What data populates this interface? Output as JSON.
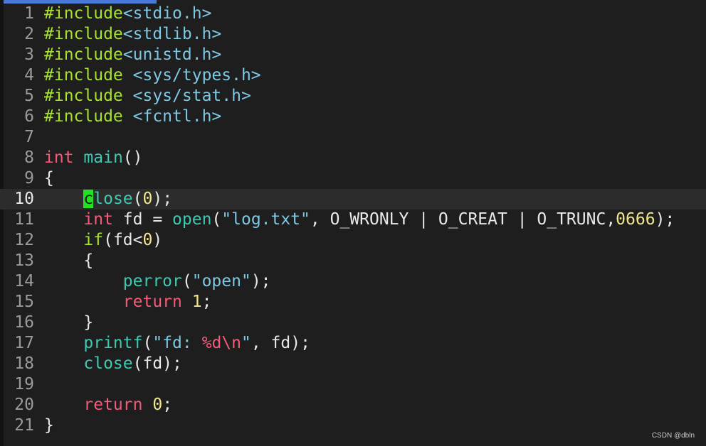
{
  "window": {
    "watermark": "CSDN @dbln"
  },
  "editor": {
    "current_line": "10",
    "lines": [
      {
        "num": "1",
        "tokens": [
          {
            "t": "#include",
            "c": "kw-pre"
          },
          {
            "t": "<stdio.h>",
            "c": "str"
          }
        ]
      },
      {
        "num": "2",
        "tokens": [
          {
            "t": "#include",
            "c": "kw-pre"
          },
          {
            "t": "<stdlib.h>",
            "c": "str"
          }
        ]
      },
      {
        "num": "3",
        "tokens": [
          {
            "t": "#include",
            "c": "kw-pre"
          },
          {
            "t": "<unistd.h>",
            "c": "str"
          }
        ]
      },
      {
        "num": "4",
        "tokens": [
          {
            "t": "#include",
            "c": "kw-pre"
          },
          {
            "t": " ",
            "c": "plain"
          },
          {
            "t": "<sys/types.h>",
            "c": "str"
          }
        ]
      },
      {
        "num": "5",
        "tokens": [
          {
            "t": "#include",
            "c": "kw-pre"
          },
          {
            "t": " ",
            "c": "plain"
          },
          {
            "t": "<sys/stat.h>",
            "c": "str"
          }
        ]
      },
      {
        "num": "6",
        "tokens": [
          {
            "t": "#include",
            "c": "kw-pre"
          },
          {
            "t": " ",
            "c": "plain"
          },
          {
            "t": "<fcntl.h>",
            "c": "str"
          }
        ]
      },
      {
        "num": "7",
        "tokens": []
      },
      {
        "num": "8",
        "tokens": [
          {
            "t": "int",
            "c": "type"
          },
          {
            "t": " ",
            "c": "plain"
          },
          {
            "t": "main",
            "c": "fn"
          },
          {
            "t": "()",
            "c": "plain"
          }
        ]
      },
      {
        "num": "9",
        "tokens": [
          {
            "t": "{",
            "c": "plain"
          }
        ]
      },
      {
        "num": "10",
        "tokens": [
          {
            "t": "    ",
            "c": "plain"
          },
          {
            "t": "c",
            "c": "cursor"
          },
          {
            "t": "lose",
            "c": "fn"
          },
          {
            "t": "(",
            "c": "plain"
          },
          {
            "t": "0",
            "c": "num"
          },
          {
            "t": ");",
            "c": "plain"
          }
        ]
      },
      {
        "num": "11",
        "tokens": [
          {
            "t": "    ",
            "c": "plain"
          },
          {
            "t": "int",
            "c": "type"
          },
          {
            "t": " fd = ",
            "c": "plain"
          },
          {
            "t": "open",
            "c": "fn"
          },
          {
            "t": "(",
            "c": "plain"
          },
          {
            "t": "\"log.txt\"",
            "c": "str"
          },
          {
            "t": ", O_WRONLY | O_CREAT | O_TRUNC,",
            "c": "plain"
          },
          {
            "t": "0666",
            "c": "num"
          },
          {
            "t": ");",
            "c": "plain"
          }
        ]
      },
      {
        "num": "12",
        "tokens": [
          {
            "t": "    ",
            "c": "plain"
          },
          {
            "t": "if",
            "c": "kw-pre"
          },
          {
            "t": "(fd<",
            "c": "plain"
          },
          {
            "t": "0",
            "c": "num"
          },
          {
            "t": ")",
            "c": "plain"
          }
        ]
      },
      {
        "num": "13",
        "tokens": [
          {
            "t": "    {",
            "c": "plain"
          }
        ]
      },
      {
        "num": "14",
        "tokens": [
          {
            "t": "        ",
            "c": "plain"
          },
          {
            "t": "perror",
            "c": "fn"
          },
          {
            "t": "(",
            "c": "plain"
          },
          {
            "t": "\"open\"",
            "c": "str"
          },
          {
            "t": ");",
            "c": "plain"
          }
        ]
      },
      {
        "num": "15",
        "tokens": [
          {
            "t": "        ",
            "c": "plain"
          },
          {
            "t": "return",
            "c": "type"
          },
          {
            "t": " ",
            "c": "plain"
          },
          {
            "t": "1",
            "c": "num"
          },
          {
            "t": ";",
            "c": "plain"
          }
        ]
      },
      {
        "num": "16",
        "tokens": [
          {
            "t": "    }",
            "c": "plain"
          }
        ]
      },
      {
        "num": "17",
        "tokens": [
          {
            "t": "    ",
            "c": "plain"
          },
          {
            "t": "printf",
            "c": "fn"
          },
          {
            "t": "(",
            "c": "plain"
          },
          {
            "t": "\"fd: ",
            "c": "str"
          },
          {
            "t": "%d\\n",
            "c": "fmt"
          },
          {
            "t": "\"",
            "c": "str"
          },
          {
            "t": ", fd);",
            "c": "plain"
          }
        ]
      },
      {
        "num": "18",
        "tokens": [
          {
            "t": "    ",
            "c": "plain"
          },
          {
            "t": "close",
            "c": "fn"
          },
          {
            "t": "(fd);",
            "c": "plain"
          }
        ]
      },
      {
        "num": "19",
        "tokens": []
      },
      {
        "num": "20",
        "tokens": [
          {
            "t": "    ",
            "c": "plain"
          },
          {
            "t": "return",
            "c": "type"
          },
          {
            "t": " ",
            "c": "plain"
          },
          {
            "t": "0",
            "c": "num"
          },
          {
            "t": ";",
            "c": "plain"
          }
        ]
      },
      {
        "num": "21",
        "tokens": [
          {
            "t": "}",
            "c": "plain"
          }
        ]
      }
    ]
  }
}
